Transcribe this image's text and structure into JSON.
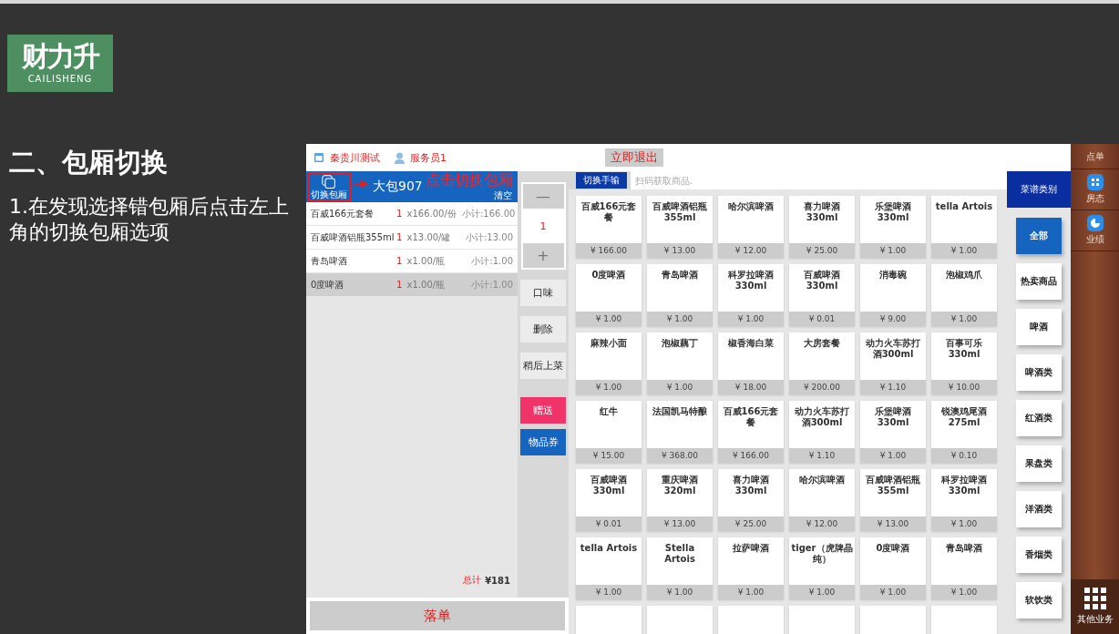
{
  "logo": {
    "mark": "财力升",
    "wordmark": "CAILISHENG"
  },
  "slide": {
    "title": "二、包厢切换",
    "text": "1.在发现选择错包厢后点击左上角的切换包厢选项"
  },
  "top_bar": {
    "store": "秦贵川测试",
    "staff": "服务员1",
    "exit_button": "立即退出"
  },
  "room": {
    "switch_label": "切换包厢",
    "name": "大包907",
    "clear": "清空"
  },
  "annotation": "点击切换包厢",
  "order_items": [
    {
      "name": "百威166元套餐",
      "qty": "1",
      "unit": "x166.00/份",
      "subtotal": "小计:166.00",
      "selected": false
    },
    {
      "name": "百威啤酒铝瓶355ml",
      "qty": "1",
      "unit": "x13.00/罐",
      "subtotal": "小计:13.00",
      "selected": false
    },
    {
      "name": "青岛啤酒",
      "qty": "1",
      "unit": "x1.00/瓶",
      "subtotal": "小计:1.00",
      "selected": false
    },
    {
      "name": "0度啤酒",
      "qty": "1",
      "unit": "x1.00/瓶",
      "subtotal": "小计:1.00",
      "selected": true
    }
  ],
  "total_label": "总计",
  "total": "¥181",
  "submit": "落单",
  "quantity": {
    "minus": "—",
    "value": "1",
    "plus": "+"
  },
  "actions": [
    {
      "label": "口味",
      "kind": "plain"
    },
    {
      "label": "删除",
      "kind": "plain"
    },
    {
      "label": "稍后上菜",
      "kind": "plain"
    },
    {
      "label": "赠送",
      "kind": "gift"
    },
    {
      "label": "物品券",
      "kind": "voucher"
    }
  ],
  "input_mode_button": "切换手输",
  "scan_placeholder": "扫码获取商品.",
  "products": [
    {
      "name": "百威166元套餐",
      "price": "¥ 166.00"
    },
    {
      "name": "百威啤酒铝瓶355ml",
      "price": "¥ 13.00"
    },
    {
      "name": "哈尔滨啤酒",
      "price": "¥ 12.00"
    },
    {
      "name": "喜力啤酒330ml",
      "price": "¥ 25.00"
    },
    {
      "name": "乐堡啤酒330ml",
      "price": "¥ 1.00"
    },
    {
      "name": "tella Artois",
      "price": "¥ 1.00"
    },
    {
      "name": "0度啤酒",
      "price": "¥ 1.00"
    },
    {
      "name": "青岛啤酒",
      "price": "¥ 1.00"
    },
    {
      "name": "科罗拉啤酒330ml",
      "price": "¥ 1.00"
    },
    {
      "name": "百威啤酒330ml",
      "price": "¥ 0.01"
    },
    {
      "name": "消毒碗",
      "price": "¥ 9.00"
    },
    {
      "name": "泡椒鸡爪",
      "price": "¥ 1.00"
    },
    {
      "name": "麻辣小面",
      "price": "¥ 1.00"
    },
    {
      "name": "泡椒藕丁",
      "price": "¥ 1.00"
    },
    {
      "name": "椒香海白菜",
      "price": "¥ 18.00"
    },
    {
      "name": "大房套餐",
      "price": "¥ 200.00"
    },
    {
      "name": "动力火车苏打酒300ml",
      "price": "¥ 1.10"
    },
    {
      "name": "百事可乐330ml",
      "price": "¥ 10.00"
    },
    {
      "name": "红牛",
      "price": "¥ 15.00"
    },
    {
      "name": "法国凯马特酿",
      "price": "¥ 368.00"
    },
    {
      "name": "百威166元套餐",
      "price": "¥ 166.00"
    },
    {
      "name": "动力火车苏打酒300ml",
      "price": "¥ 1.10"
    },
    {
      "name": "乐堡啤酒330ml",
      "price": "¥ 1.00"
    },
    {
      "name": "锐澳鸡尾酒275ml",
      "price": "¥ 0.10"
    },
    {
      "name": "百威啤酒330ml",
      "price": "¥ 0.01"
    },
    {
      "name": "重庆啤酒320ml",
      "price": "¥ 13.00"
    },
    {
      "name": "喜力啤酒330ml",
      "price": "¥ 25.00"
    },
    {
      "name": "哈尔滨啤酒",
      "price": "¥ 12.00"
    },
    {
      "name": "百威啤酒铝瓶355ml",
      "price": "¥ 13.00"
    },
    {
      "name": "科罗拉啤酒330ml",
      "price": "¥ 1.00"
    },
    {
      "name": "tella Artois",
      "price": "¥ 1.00"
    },
    {
      "name": "Stella Artois",
      "price": "¥ 1.00"
    },
    {
      "name": "拉萨啤酒",
      "price": "¥ 1.00"
    },
    {
      "name": "tiger（虎牌晶纯）",
      "price": "¥ 1.00"
    },
    {
      "name": "0度啤酒",
      "price": "¥ 1.00"
    },
    {
      "name": "青岛啤酒",
      "price": "¥ 1.00"
    }
  ],
  "category_header": "菜谱类别",
  "categories": [
    {
      "label": "全部",
      "selected": true
    },
    {
      "label": "热卖商品",
      "selected": false
    },
    {
      "label": "啤酒",
      "selected": false
    },
    {
      "label": "啤酒类",
      "selected": false
    },
    {
      "label": "红酒类",
      "selected": false
    },
    {
      "label": "果盘类",
      "selected": false
    },
    {
      "label": "洋酒类",
      "selected": false
    },
    {
      "label": "香烟类",
      "selected": false
    },
    {
      "label": "软饮类",
      "selected": false
    }
  ],
  "side_nav": [
    {
      "label": "点单"
    },
    {
      "label": "房态",
      "kind": "rooms"
    },
    {
      "label": "业绩",
      "kind": "stats"
    }
  ],
  "more": "其他业务"
}
